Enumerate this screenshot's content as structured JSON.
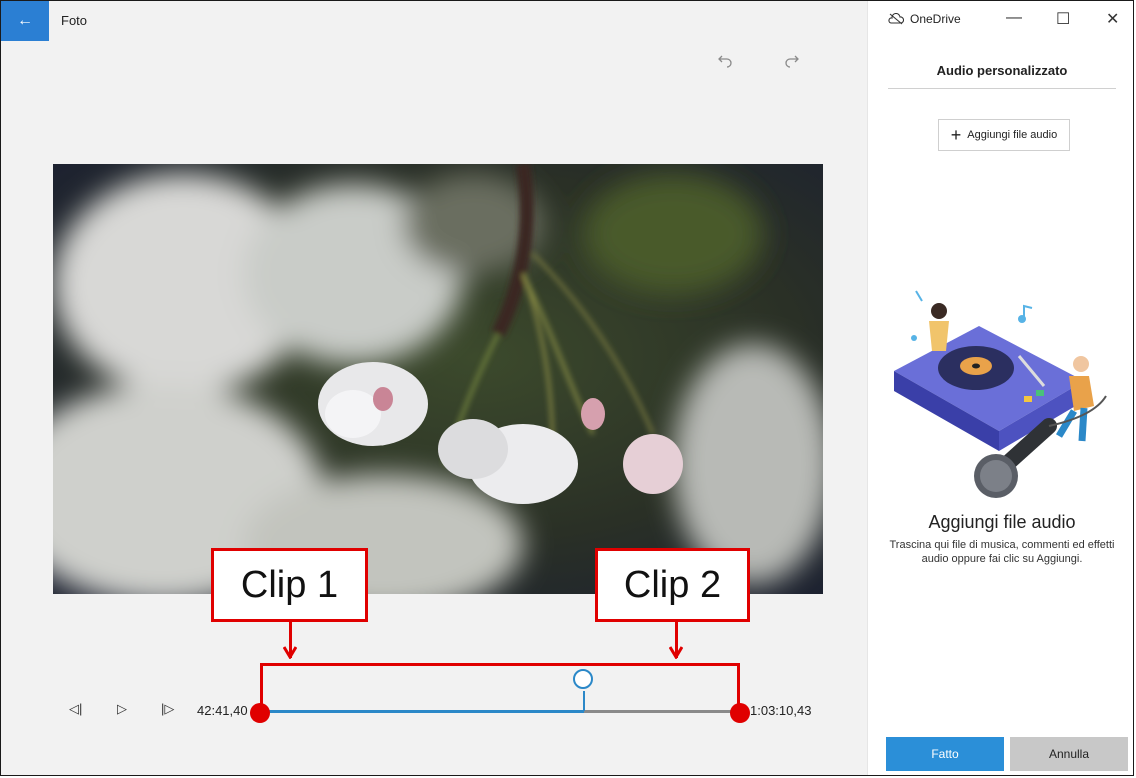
{
  "app": {
    "title": "Foto",
    "back_icon": "arrow-left-icon",
    "accent": "#2b7fd3"
  },
  "toolbar": {
    "undo_icon": "undo-icon",
    "redo_icon": "redo-icon"
  },
  "window": {
    "onedrive_label": "OneDrive",
    "minimize": "—",
    "maximize": "☐",
    "close": "✕"
  },
  "panel": {
    "title": "Audio personalizzato",
    "add_button_label": "Aggiungi file audio",
    "empty_title": "Aggiungi file audio",
    "empty_description": "Trascina qui file di musica, commenti ed effetti audio oppure fai clic su Aggiungi.",
    "done_label": "Fatto",
    "cancel_label": "Annulla",
    "done_color": "#2b8fd8"
  },
  "playback": {
    "start_time": "42:41,40",
    "end_time": "1:03:10,43",
    "progress_fraction": 0.67,
    "track_color": "#2b88c8"
  },
  "annotations": {
    "clip1_label": "Clip 1",
    "clip2_label": "Clip 2",
    "color": "#e00000"
  }
}
